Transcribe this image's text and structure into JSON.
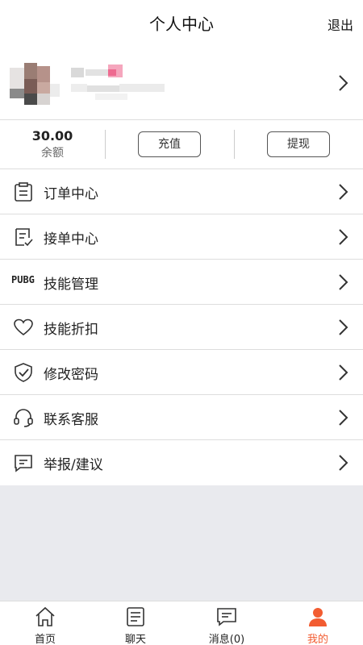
{
  "header": {
    "title": "个人中心",
    "logout_label": "退出"
  },
  "wallet": {
    "balance_value": "30.00",
    "balance_label": "余额",
    "recharge_label": "充值",
    "withdraw_label": "提现"
  },
  "menu": {
    "items": [
      {
        "label": "订单中心",
        "icon": "order-list-icon"
      },
      {
        "label": "接单中心",
        "icon": "accept-order-icon"
      },
      {
        "label": "技能管理",
        "icon": "pubg-icon",
        "icon_text": "PUBG"
      },
      {
        "label": "技能折扣",
        "icon": "heart-icon"
      },
      {
        "label": "修改密码",
        "icon": "shield-check-icon"
      },
      {
        "label": "联系客服",
        "icon": "headset-icon"
      },
      {
        "label": "举报/建议",
        "icon": "feedback-icon"
      }
    ]
  },
  "tabbar": {
    "items": [
      {
        "label": "首页",
        "icon": "home-icon"
      },
      {
        "label": "聊天",
        "icon": "chat-doc-icon"
      },
      {
        "label": "消息(0)",
        "icon": "message-icon"
      },
      {
        "label": "我的",
        "icon": "user-icon",
        "active": true
      }
    ]
  },
  "colors": {
    "accent": "#f25c31",
    "background": "#e9eaee",
    "divider": "#dddddd"
  }
}
